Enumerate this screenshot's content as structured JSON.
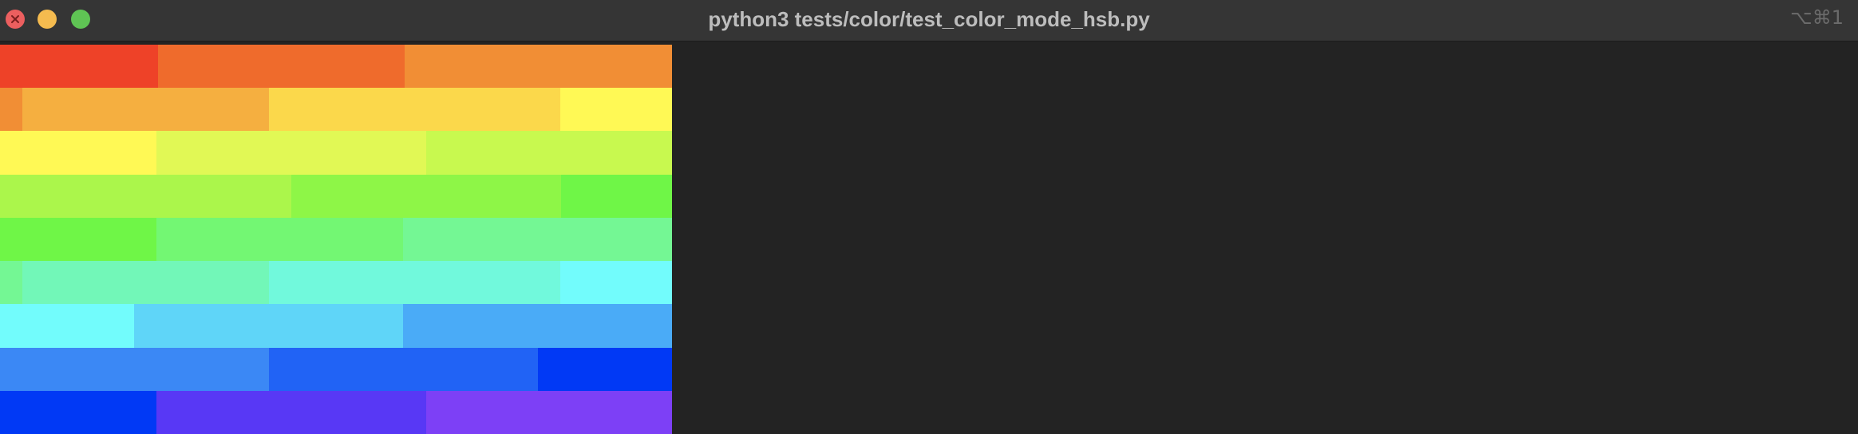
{
  "window": {
    "title": "python3 tests/color/test_color_mode_hsb.py",
    "shortcut": "⌥⌘1"
  },
  "colors": {
    "titlebar": "#353535",
    "content_bg": "#232323",
    "close": "#ec5f5f",
    "minimize": "#f5bb4f",
    "maximize": "#5fc454"
  },
  "swatch_rows": [
    [
      [
        "#ee4228",
        0.235
      ],
      [
        "#ef6b2c",
        0.367
      ],
      [
        "#f18e35",
        0.398
      ]
    ],
    [
      [
        "#f18e35",
        0.033
      ],
      [
        "#f5af40",
        0.367
      ],
      [
        "#fbd84b",
        0.433
      ],
      [
        "#fff955",
        0.167
      ]
    ],
    [
      [
        "#fff955",
        0.233
      ],
      [
        "#e1f855",
        0.401
      ],
      [
        "#c8f94f",
        0.366
      ]
    ],
    [
      [
        "#abf64b",
        0.433
      ],
      [
        "#8ef647",
        0.401
      ],
      [
        "#6ff647",
        0.166
      ]
    ],
    [
      [
        "#6ff647",
        0.233
      ],
      [
        "#73f773",
        0.367
      ],
      [
        "#74f794",
        0.4
      ]
    ],
    [
      [
        "#74f794",
        0.033
      ],
      [
        "#72f7b8",
        0.367
      ],
      [
        "#71f9dc",
        0.434
      ],
      [
        "#72fcfc",
        0.166
      ]
    ],
    [
      [
        "#72fcfc",
        0.2
      ],
      [
        "#5fd5f8",
        0.4
      ],
      [
        "#4aabf7",
        0.4
      ]
    ],
    [
      [
        "#3b88f5",
        0.4
      ],
      [
        "#2163f5",
        0.4
      ],
      [
        "#0139f5",
        0.2
      ]
    ],
    [
      [
        "#0139f5",
        0.233
      ],
      [
        "#5838f5",
        0.401
      ],
      [
        "#7d40f6",
        0.366
      ]
    ]
  ]
}
